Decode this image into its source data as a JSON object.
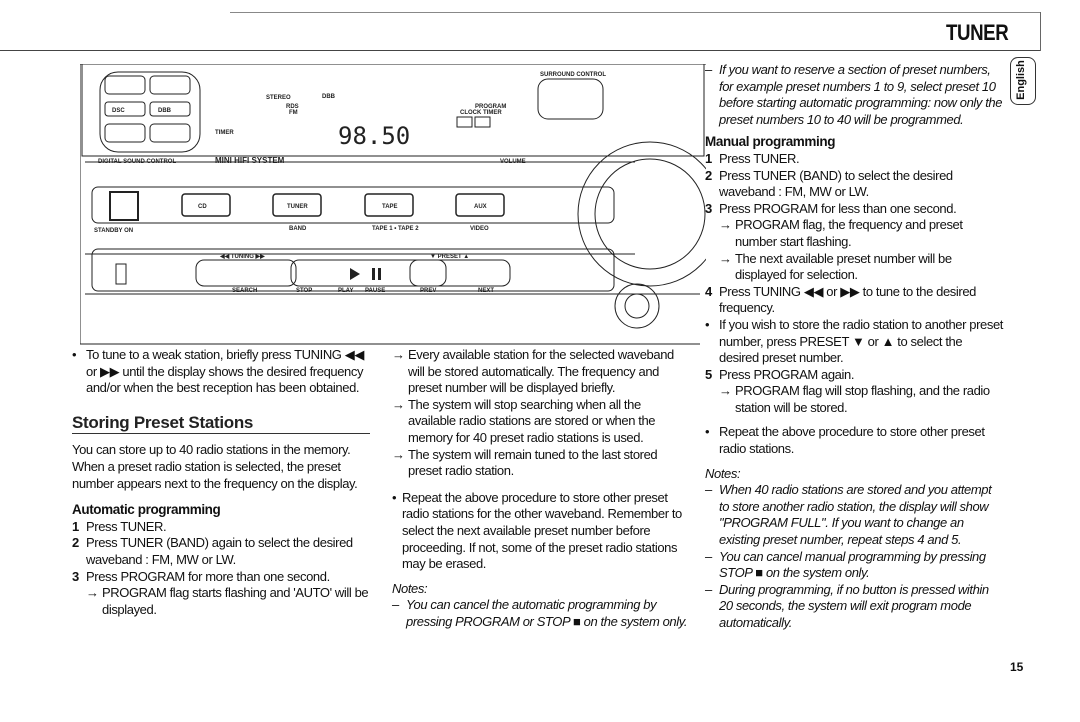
{
  "header": {
    "title": "TUNER",
    "language_tab": "English",
    "page_number": "15"
  },
  "device": {
    "digital_sound_control": "DIGITAL SOUND CONTROL",
    "model": "MINI HIFI SYSTEM",
    "timer": "TIMER",
    "stereo": "STEREO",
    "rds": "RDS",
    "fm": "FM",
    "dbb": "DBB",
    "frequency": "98.50",
    "clock_timer": "CLOCK TIMER",
    "program": "PROGRAM",
    "surround_control": "SURROUND CONTROL",
    "volume": "VOLUME",
    "standby": "STANDBY ON",
    "cd": "CD",
    "tuner": "TUNER",
    "band": "BAND",
    "tape": "TAPE",
    "tape12": "TAPE 1 • TAPE 2",
    "aux": "AUX",
    "video": "VIDEO",
    "tuning": "◀◀ TUNING ▶▶",
    "search": "SEARCH",
    "stop": "STOP",
    "play": "PLAY",
    "pause": "PAUSE",
    "preset": "▼ PRESET ▲",
    "prev": "PREV",
    "next": "NEXT",
    "dsc": "DSC",
    "dbb_btn": "DBB"
  },
  "left": {
    "bullet1": "To tune to a weak station, briefly press TUNING ◀◀ or ▶▶ until the display shows the desired frequency and/or when the best reception has been obtained.",
    "heading": "Storing Preset Stations",
    "intro": "You can store up to 40 radio stations in the memory. When a preset radio station is selected, the preset number appears next to the frequency on the display.",
    "auto_heading": "Automatic programming",
    "steps": [
      {
        "n": "1",
        "text": "Press TUNER."
      },
      {
        "n": "2",
        "text": "Press TUNER (BAND) again to select the desired waveband : FM, MW or LW."
      },
      {
        "n": "3",
        "text": "Press PROGRAM for more than one second."
      }
    ],
    "step3_sub": "PROGRAM flag starts flashing and 'AUTO' will be displayed."
  },
  "middle": {
    "subs": [
      "Every available station for the selected waveband will be stored automatically. The frequency and preset number will be displayed briefly.",
      "The system  will stop searching when all the available radio stations are stored or when the memory for 40 preset radio stations is used.",
      "The system will remain tuned to the last stored preset radio station."
    ],
    "bullet": "Repeat the above procedure to store other preset radio stations for the other waveband. Remember to select the next available preset number before proceeding. If not, some of the preset radio stations may be erased.",
    "notes_label": "Notes:",
    "note": "You can cancel the automatic programming by pressing PROGRAM or STOP ■ on the system only."
  },
  "right": {
    "note_top": "If you want to reserve a section of  preset numbers, for example preset numbers 1 to 9, select preset 10 before starting automatic programming: now only the preset numbers 10 to 40 will be programmed.",
    "manual_heading": "Manual programming",
    "step1": "Press TUNER.",
    "step2": "Press TUNER (BAND) to select the desired waveband : FM, MW or LW.",
    "step3": "Press PROGRAM for less than one second.",
    "step3_subs": [
      "PROGRAM flag, the frequency and preset number start flashing.",
      "The next available preset number will be displayed for selection."
    ],
    "step4": "Press TUNING ◀◀ or ▶▶ to tune to the desired frequency.",
    "bullet_preset": "If you wish to store the radio station to another preset number, press PRESET ▼ or ▲ to select the desired preset number.",
    "step5": "Press PROGRAM again.",
    "step5_sub": "PROGRAM flag will stop flashing, and the radio station will be stored.",
    "bullet_repeat": "Repeat the above procedure to store other preset radio stations.",
    "notes_label": "Notes:",
    "notes": [
      "When 40 radio stations are stored and you attempt to store another radio station, the display will show \"PROGRAM FULL\". If you want to change an existing preset number, repeat steps 4 and 5.",
      "You can cancel manual programming by pressing STOP ■ on the system only.",
      "During programming,  if no button is pressed within 20 seconds, the system will exit program mode automatically."
    ]
  }
}
